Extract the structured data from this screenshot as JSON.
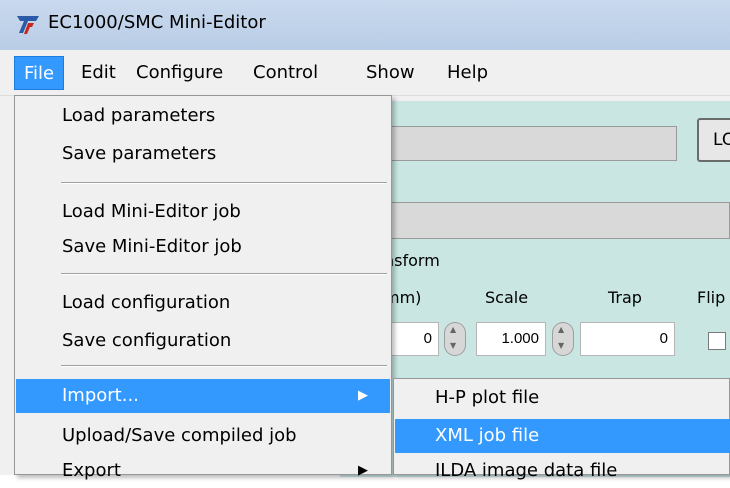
{
  "window": {
    "title": "EC1000/SMC Mini-Editor",
    "icon": "ec-logo-icon"
  },
  "menubar": {
    "items": [
      "File",
      "Edit",
      "Configure",
      "Control",
      "Show",
      "Help"
    ],
    "active": "File"
  },
  "background": {
    "load_button": "LO",
    "section_title": "nsform",
    "col_mm": "mm)",
    "col_scale": "Scale",
    "col_trap": "Trap",
    "col_flip": "Flip",
    "val_offset": "0",
    "val_scale": "1.000",
    "val_trap": "0"
  },
  "file_menu": {
    "items": [
      {
        "label": "Load parameters"
      },
      {
        "label": "Save parameters"
      },
      {
        "label": "Load Mini-Editor job"
      },
      {
        "label": "Save Mini-Editor job"
      },
      {
        "label": "Load configuration"
      },
      {
        "label": "Save configuration"
      },
      {
        "label": "Import...",
        "submenu": true,
        "highlighted": true
      },
      {
        "label": "Upload/Save compiled job"
      },
      {
        "label": "Export",
        "submenu": true
      }
    ]
  },
  "import_submenu": {
    "items": [
      {
        "label": "H-P plot file"
      },
      {
        "label": "XML job file",
        "highlighted": true
      },
      {
        "label": "ILDA image data file"
      }
    ]
  },
  "colors": {
    "highlight": "#3399ff",
    "menu_bg": "#f0f0f0",
    "panel_teal": "#c9e6e3"
  }
}
